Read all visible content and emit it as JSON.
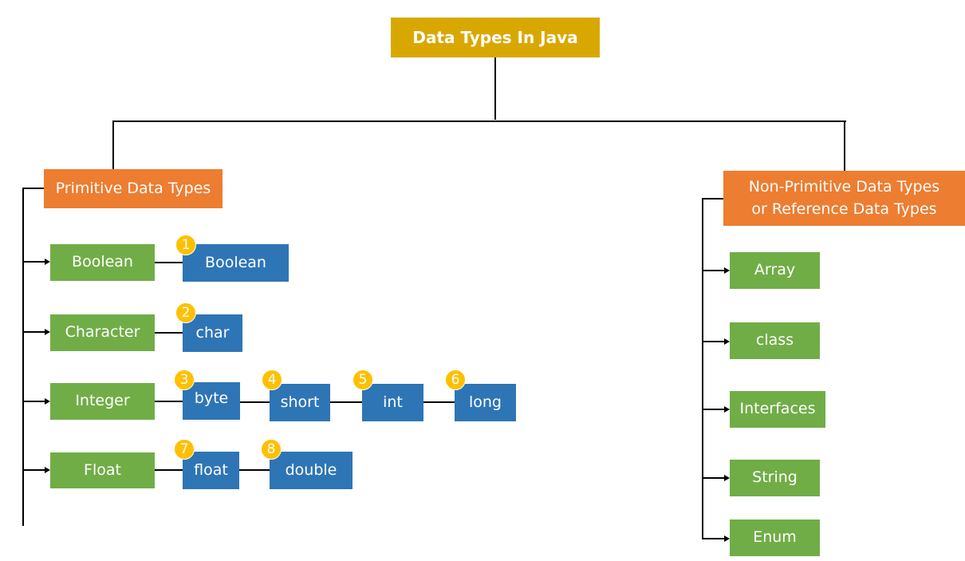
{
  "title": "Data Types In Java",
  "primitive": {
    "label": "Primitive Data Types",
    "categories": [
      {
        "label": "Boolean",
        "types": [
          {
            "n": "1",
            "label": "Boolean"
          }
        ]
      },
      {
        "label": "Character",
        "types": [
          {
            "n": "2",
            "label": "char"
          }
        ]
      },
      {
        "label": "Integer",
        "types": [
          {
            "n": "3",
            "label": "byte"
          },
          {
            "n": "4",
            "label": "short"
          },
          {
            "n": "5",
            "label": "int"
          },
          {
            "n": "6",
            "label": "long"
          }
        ]
      },
      {
        "label": "Float",
        "types": [
          {
            "n": "7",
            "label": "float"
          },
          {
            "n": "8",
            "label": "double"
          }
        ]
      }
    ]
  },
  "non_primitive": {
    "label_line1": "Non-Primitive Data Types",
    "label_line2": "or Reference Data Types",
    "items": [
      "Array",
      "class",
      "Interfaces",
      "String",
      "Enum"
    ]
  },
  "colors": {
    "title": "#D9A800",
    "group": "#ED7D31",
    "category": "#70AD47",
    "type": "#2E75B6",
    "badge": "#FFC000"
  }
}
